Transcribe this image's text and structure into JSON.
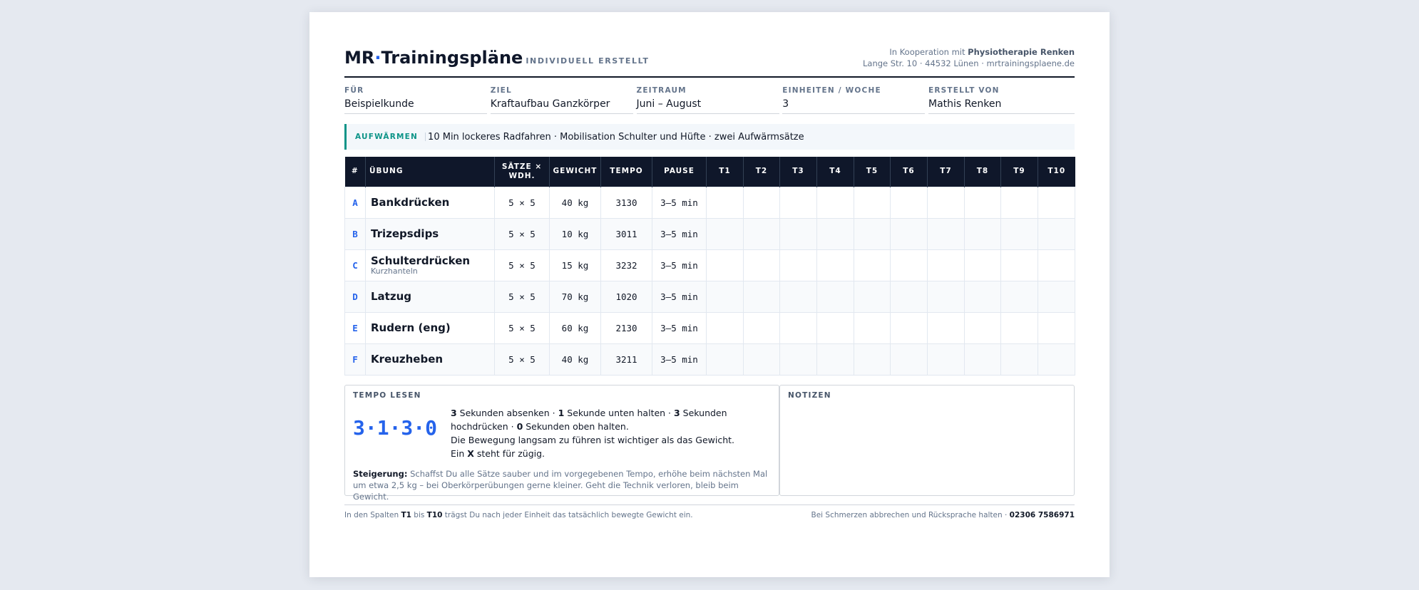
{
  "header": {
    "brand_left": "MR",
    "brand_dot": "·",
    "brand_right": "Trainingspläne",
    "tagline": "INDIVIDUELL ERSTELLT",
    "coop_prefix": "In Kooperation mit",
    "coop_name": "Physiotherapie Renken",
    "address": "Lange Str. 10 · 44532 Lünen · mrtrainingsplaene.de"
  },
  "meta": [
    {
      "label": "FÜR",
      "value": "Beispielkunde"
    },
    {
      "label": "ZIEL",
      "value": "Kraftaufbau Ganzkörper"
    },
    {
      "label": "ZEITRAUM",
      "value": "Juni – August"
    },
    {
      "label": "EINHEITEN / WOCHE",
      "value": "3"
    },
    {
      "label": "ERSTELLT VON",
      "value": "Mathis Renken"
    }
  ],
  "warmup": {
    "label": "AUFWÄRMEN",
    "text": "10 Min lockeres Radfahren · Mobilisation Schulter und Hüfte · zwei Aufwärmsätze"
  },
  "table": {
    "headers": {
      "id": "#",
      "name": "ÜBUNG",
      "sets_1": "SÄTZE ×",
      "sets_2": "WDH.",
      "weight": "GEWICHT",
      "tempo": "TEMPO",
      "rest": "PAUSE",
      "logs": [
        "T1",
        "T2",
        "T3",
        "T4",
        "T5",
        "T6",
        "T7",
        "T8",
        "T9",
        "T10"
      ]
    },
    "rows": [
      {
        "id": "A",
        "name": "Bankdrücken",
        "sub": "",
        "sets": "5 × 5",
        "weight": "40 kg",
        "tempo": "3130",
        "rest": "3–5 min"
      },
      {
        "id": "B",
        "name": "Trizepsdips",
        "sub": "",
        "sets": "5 × 5",
        "weight": "10 kg",
        "tempo": "3011",
        "rest": "3–5 min"
      },
      {
        "id": "C",
        "name": "Schulterdrücken",
        "sub": "Kurzhanteln",
        "sets": "5 × 5",
        "weight": "15 kg",
        "tempo": "3232",
        "rest": "3–5 min"
      },
      {
        "id": "D",
        "name": "Latzug",
        "sub": "",
        "sets": "5 × 5",
        "weight": "70 kg",
        "tempo": "1020",
        "rest": "3–5 min"
      },
      {
        "id": "E",
        "name": "Rudern (eng)",
        "sub": "",
        "sets": "5 × 5",
        "weight": "60 kg",
        "tempo": "2130",
        "rest": "3–5 min"
      },
      {
        "id": "F",
        "name": "Kreuzheben",
        "sub": "",
        "sets": "5 × 5",
        "weight": "40 kg",
        "tempo": "3211",
        "rest": "3–5 min"
      }
    ]
  },
  "tempo_box": {
    "title": "TEMPO LESEN",
    "big": "3·1·3·0",
    "d1": "3",
    "t1": " Sekunden absenken  ·  ",
    "d2": "1",
    "t2": " Sekunde unten halten  ·  ",
    "d3": "3",
    "t3": " Sekunden hochdrücken  ·  ",
    "d4": "0",
    "t4": " Sekunden oben halten.",
    "line2_a": "Die Bewegung langsam zu führen ist wichtiger als das Gewicht. Ein ",
    "line2_x": "X",
    "line2_b": " steht für zügig.",
    "prog_label": "Steigerung:",
    "prog_text": " Schaffst Du alle Sätze sauber und im vorgegebenen Tempo, erhöhe beim nächsten Mal um etwa 2,5 kg – bei Oberkörperübungen gerne kleiner. Geht die Technik verloren, bleib beim Gewicht."
  },
  "notes_box": {
    "title": "NOTIZEN"
  },
  "footer": {
    "left_a": "In den Spalten ",
    "left_t1": "T1",
    "left_b": " bis ",
    "left_t10": "T10",
    "left_c": " trägst Du nach jeder Einheit das tatsächlich bewegte Gewicht ein.",
    "right_a": "Bei Schmerzen abbrechen und Rücksprache halten · ",
    "right_phone": "02306 7586971"
  }
}
